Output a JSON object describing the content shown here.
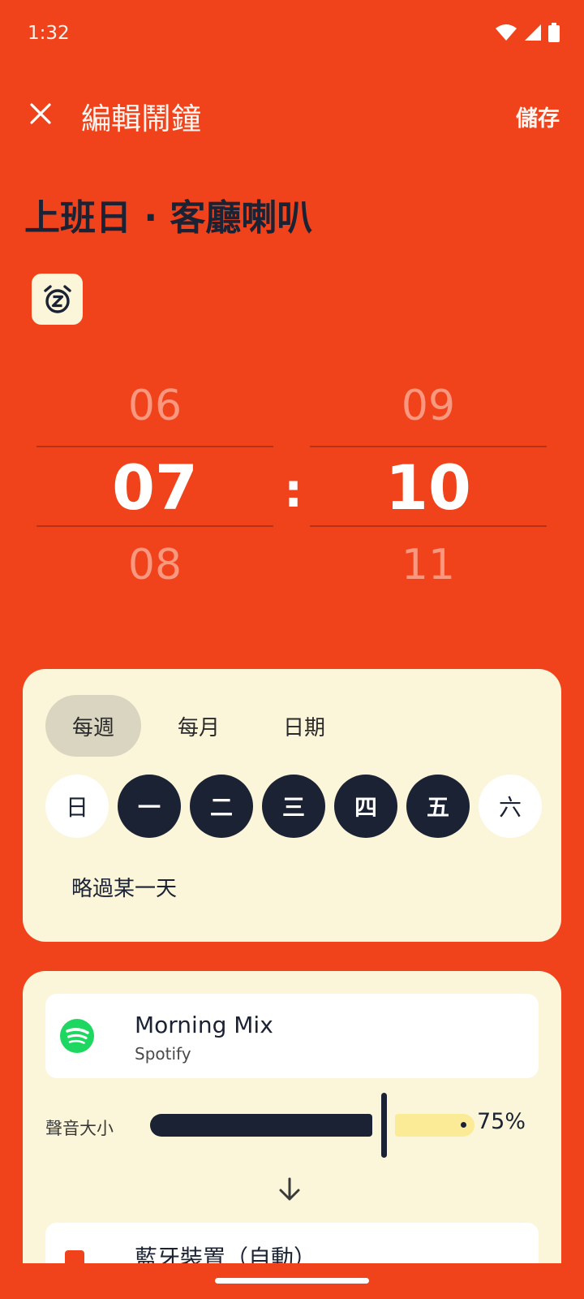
{
  "status": {
    "time": "1:32"
  },
  "header": {
    "title": "編輯鬧鐘",
    "save_label": "儲存"
  },
  "alarm": {
    "name": "上班日 · 客廳喇叭"
  },
  "picker": {
    "hours": {
      "prev": "06",
      "selected": "07",
      "next": "08"
    },
    "minutes": {
      "prev": "09",
      "selected": "10",
      "next": "11"
    },
    "separator": ":"
  },
  "repeat": {
    "tabs": [
      {
        "label": "每週",
        "active": true
      },
      {
        "label": "每月",
        "active": false
      },
      {
        "label": "日期",
        "active": false
      }
    ],
    "days": [
      {
        "label": "日",
        "selected": false
      },
      {
        "label": "一",
        "selected": true
      },
      {
        "label": "二",
        "selected": true
      },
      {
        "label": "三",
        "selected": true
      },
      {
        "label": "四",
        "selected": true
      },
      {
        "label": "五",
        "selected": true
      },
      {
        "label": "六",
        "selected": false
      }
    ],
    "skip_label": "略過某一天"
  },
  "sound": {
    "media": {
      "title": "Morning Mix",
      "source": "Spotify"
    },
    "volume": {
      "label": "聲音大小",
      "value_text": "75%",
      "level": 0.72
    },
    "output": {
      "label": "藍牙裝置（自動）"
    }
  },
  "colors": {
    "background": "#F0431B",
    "card": "#FBF5D9",
    "dark": "#1A2233",
    "spotify": "#1ED760",
    "volume_rest": "#FCEB96"
  }
}
